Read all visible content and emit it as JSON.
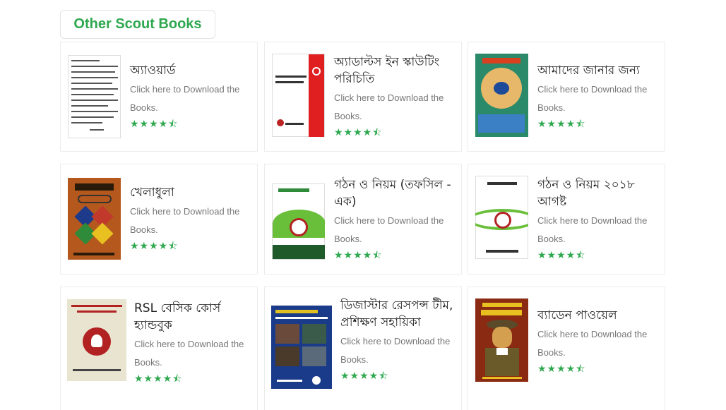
{
  "section": {
    "title": "Other Scout Books"
  },
  "common": {
    "description": "Click here to Download the Books."
  },
  "rating": {
    "value": 4.5,
    "max": 5,
    "color": "#2fa84f"
  },
  "books": [
    {
      "title": "অ্যাওয়ার্ড",
      "cover_colors": [
        "#ffffff",
        "#444444"
      ]
    },
    {
      "title": "অ্যাডাল্টস ইন স্কাউটিং পরিচিতি",
      "cover_colors": [
        "#ffffff",
        "#e02020"
      ]
    },
    {
      "title": "আমাদের জানার জন্য",
      "cover_colors": [
        "#2a8a6a",
        "#e8b86a"
      ]
    },
    {
      "title": "খেলাধুলা",
      "cover_colors": [
        "#b5581e",
        "#1e3a8a"
      ]
    },
    {
      "title": "গঠন ও নিয়ম (তফসিল - এক)",
      "cover_colors": [
        "#ffffff",
        "#2e8b3a"
      ]
    },
    {
      "title": "গঠন ও নিয়ম ২০১৮ আগষ্ট",
      "cover_colors": [
        "#ffffff",
        "#2e8b3a"
      ]
    },
    {
      "title": "RSL বেসিক কোর্স হ্যান্ডবুক",
      "cover_colors": [
        "#e8e4d0",
        "#b22222"
      ]
    },
    {
      "title": "ডিজাস্টার রেসপন্স টীম, প্রশিক্ষণ সহায়িকা",
      "cover_colors": [
        "#1a3a8a",
        "#6a4a3a"
      ]
    },
    {
      "title": "ব্যাডেন পাওয়েল",
      "cover_colors": [
        "#8a2a12",
        "#d4a050"
      ]
    }
  ]
}
